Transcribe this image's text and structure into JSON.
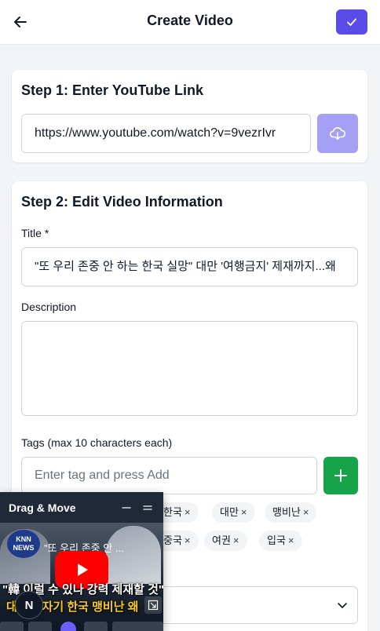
{
  "header": {
    "title": "Create Video"
  },
  "step1": {
    "title": "Step 1: Enter YouTube Link",
    "url_value": "https://www.youtube.com/watch?v=9vezrIvr"
  },
  "step2": {
    "title": "Step 2: Edit Video Information",
    "title_label": "Title *",
    "title_value": "\"또 우리 존중 안 하는 한국 실망\" 대만 '여행금지' 제재까지...왜",
    "description_label": "Description",
    "description_value": "",
    "tags_label": "Tags (max 10 characters each)",
    "tag_placeholder": "Enter tag and press Add",
    "tags": [
      {
        "label": "한국",
        "remove": "×"
      },
      {
        "label": "대만",
        "remove": "×"
      },
      {
        "label": "맹비난",
        "remove": "×"
      },
      {
        "label": "중국",
        "remove": "×"
      },
      {
        "label": "여권",
        "remove": "×"
      },
      {
        "label": "입국",
        "remove": "×"
      }
    ]
  },
  "floating_player": {
    "title": "Drag & Move",
    "logo_text_1": "KNN",
    "logo_text_2": "NEWS",
    "overlay_title": "\"또 우리 존중 안 ...",
    "caption_line_1": "\"韓 이럴 수 있나 강력 제재할 것\"",
    "caption_line_2": "대만 돌자기 한국 맹비난 왜",
    "n_button": "N"
  },
  "colors": {
    "primary": "#5b4ce8",
    "primary_light": "#a5a0f5",
    "success": "#16a34a",
    "youtube_red": "#ff0000"
  },
  "icons": {
    "back": "arrow-left-icon",
    "confirm": "check-icon",
    "download": "cloud-download-icon",
    "add": "plus-icon",
    "select": "chevron-down-icon",
    "minimize": "minimize-icon",
    "menu": "menu-icon",
    "play": "play-icon",
    "expand": "expand-icon"
  }
}
